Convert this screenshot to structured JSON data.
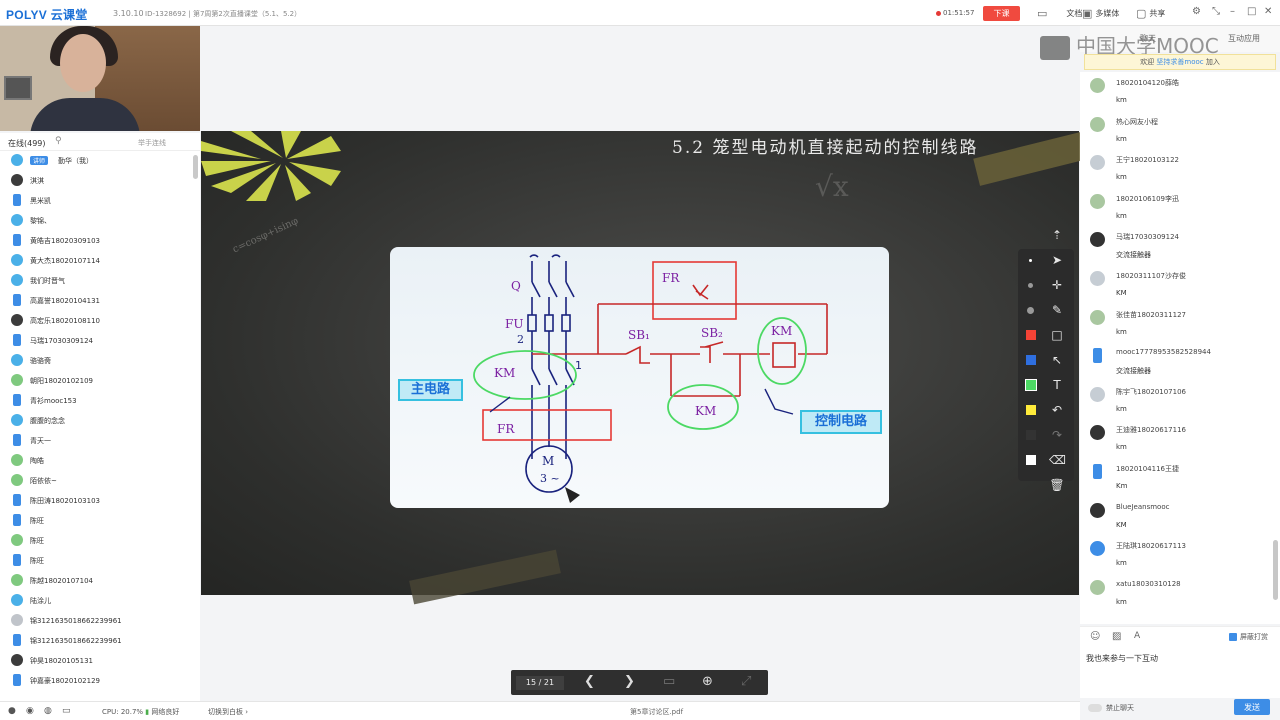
{
  "app": {
    "logo": "POLYV 云课堂",
    "version": "3.10.10",
    "session_title": "ID-1328692 | 第7周第2次直播课堂（5.1、5.2）"
  },
  "top": {
    "record_time": "01:51:57",
    "end_label": "下课",
    "docs": "文档",
    "media": "多媒体",
    "share": "共享"
  },
  "left": {
    "online_count": "在线(499)",
    "filter_label": "举手连线",
    "teacher_tag": "讲师",
    "users": [
      {
        "name": "勤华（我）",
        "av": "b"
      },
      {
        "name": "淇淇",
        "av": "d"
      },
      {
        "name": "黑米凯",
        "av": "phone"
      },
      {
        "name": "黎锦、",
        "av": "b"
      },
      {
        "name": "黄皓吉18020309103",
        "av": "phone"
      },
      {
        "name": "黄大杰18020107114",
        "av": "b"
      },
      {
        "name": "我们时晋气",
        "av": "b"
      },
      {
        "name": "高嘉誉18020104131",
        "av": "phone"
      },
      {
        "name": "高宏乐18020108110",
        "av": "d"
      },
      {
        "name": "马瑞17030309124",
        "av": "phone"
      },
      {
        "name": "骆骆斋",
        "av": "b"
      },
      {
        "name": "朝阳18020102109",
        "av": "g"
      },
      {
        "name": "青衫mooc153",
        "av": "phone"
      },
      {
        "name": "腹腹的念念",
        "av": "b"
      },
      {
        "name": "青天一",
        "av": "phone"
      },
      {
        "name": "陶皓",
        "av": "g"
      },
      {
        "name": "陌依依~",
        "av": "g"
      },
      {
        "name": "陈田涛18020103103",
        "av": "phone"
      },
      {
        "name": "陈旺",
        "av": "phone"
      },
      {
        "name": "陈旺",
        "av": "g"
      },
      {
        "name": "陈旺",
        "av": "phone"
      },
      {
        "name": "陈越18020107104",
        "av": "g"
      },
      {
        "name": "陆涂儿",
        "av": "b"
      },
      {
        "name": "锦3121635018662239961",
        "av": "p"
      },
      {
        "name": "锦3121635018662239961",
        "av": "phone"
      },
      {
        "name": "钟昊18020105131",
        "av": "d"
      },
      {
        "name": "钟嘉豪18020102129",
        "av": "phone"
      }
    ]
  },
  "status": {
    "cpu": "CPU: 20.7%",
    "network": "网络良好",
    "to_board": "切换到白板",
    "file": "第5章讨论区.pdf"
  },
  "slide": {
    "title": "5.2 笼型电动机直接起动的控制线路",
    "labels": {
      "q": "Q",
      "fu": "FU",
      "two": "2",
      "km_main": "KM",
      "fr_main": "FR",
      "m": "M",
      "m3": "3 ~",
      "fr_top": "FR",
      "sb1": "SB₁",
      "sb2": "SB₂",
      "km_coil": "KM",
      "km_aux": "KM",
      "one": "1",
      "main_circuit": "主电路",
      "control_circuit": "控制电路"
    }
  },
  "pager": {
    "page": "15 / 21"
  },
  "right": {
    "brand": "中国大学MOOC",
    "tab_chat": "聊天",
    "tab_app": "互动应用",
    "welcome_prefix": "欢迎",
    "welcome_user": "坚持求善mooc",
    "welcome_suffix": "加入",
    "messages": [
      {
        "name": "18020104120薛皓",
        "text": "km",
        "av": "y"
      },
      {
        "name": "热心网友小程",
        "text": "km",
        "av": "y"
      },
      {
        "name": "王宁18020103122",
        "text": "km",
        "av": "p"
      },
      {
        "name": "18020106109李迅",
        "text": "km",
        "av": "y"
      },
      {
        "name": "马瑞17030309124",
        "text": "交流接触器",
        "av": "d"
      },
      {
        "name": "18020311107沙存俊",
        "text": "KM",
        "av": "p"
      },
      {
        "name": "张佳苗18020311127",
        "text": "km",
        "av": "y"
      },
      {
        "name": "mooc1777895358252894​4",
        "text": "交流接触器",
        "av": "ph"
      },
      {
        "name": "陈宇飞18020107106",
        "text": "km",
        "av": "p"
      },
      {
        "name": "王迪雅18020617116",
        "text": "km",
        "av": "d"
      },
      {
        "name": "18020104116王捷",
        "text": "Km",
        "av": "ph"
      },
      {
        "name": "BlueJeansmooc",
        "text": "KM",
        "av": "d"
      },
      {
        "name": "王陆琪18020617113",
        "text": "km",
        "av": "b"
      },
      {
        "name": "xatu18030310128",
        "text": "km",
        "av": "y"
      }
    ],
    "block_screen": "屏蔽打赏",
    "input_value": "我也来参与一下互动",
    "mute_label": "禁止聊天",
    "send_label": "发送"
  }
}
